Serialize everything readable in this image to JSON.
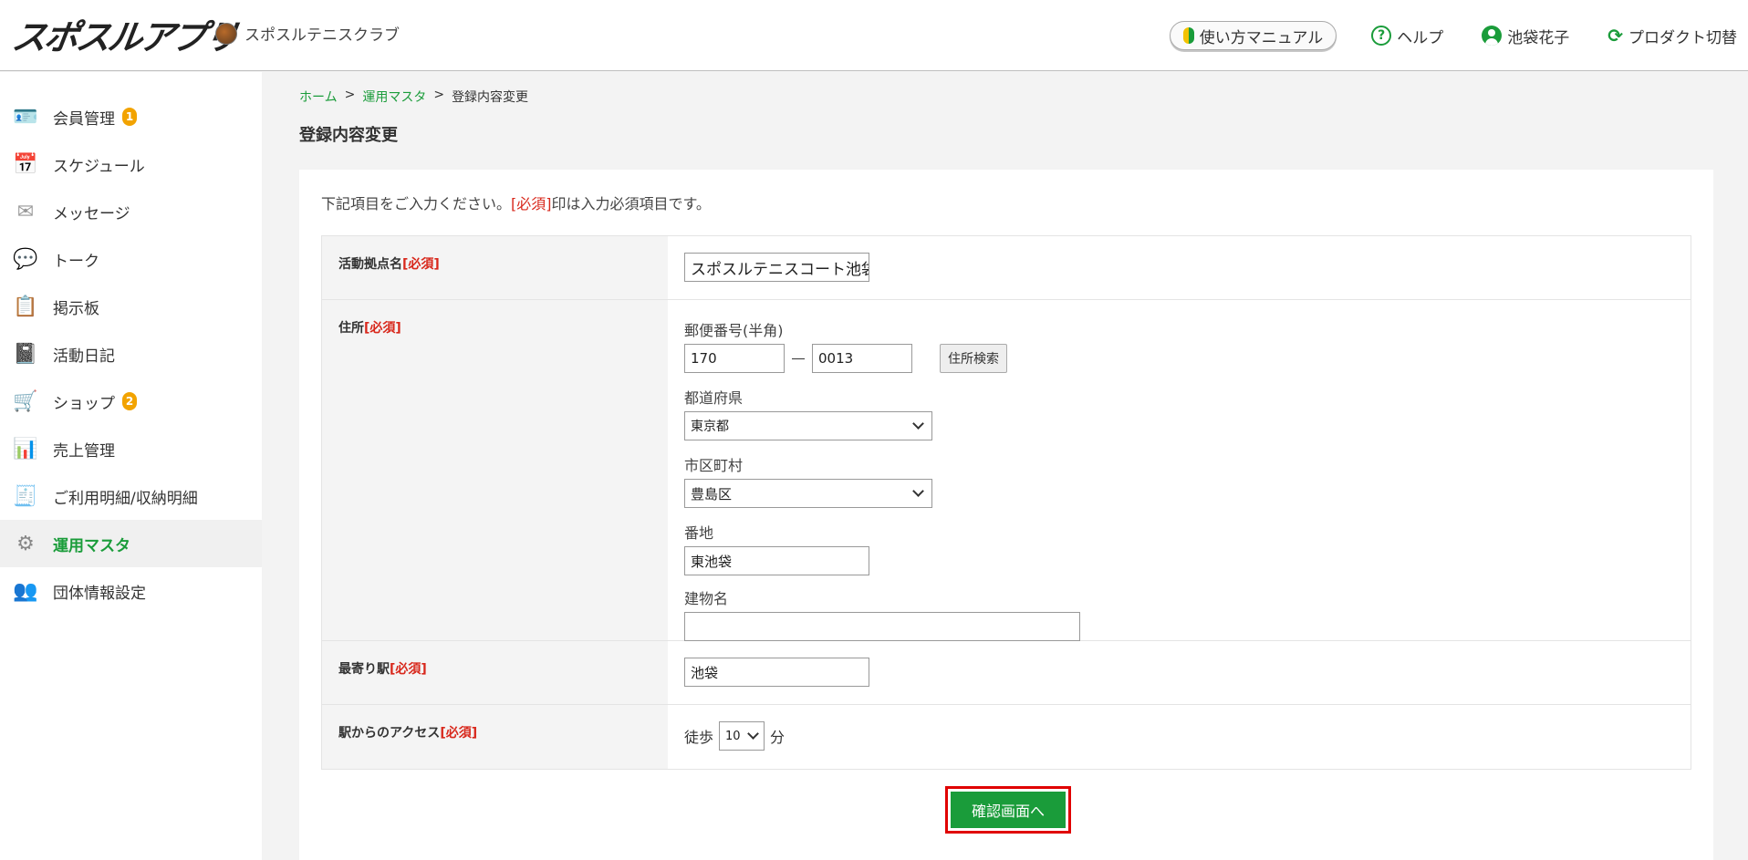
{
  "header": {
    "logo": "スポスルアプリ",
    "club_name": "スポスルテニスクラブ",
    "manual_label": "使い方マニュアル",
    "help_label": "ヘルプ",
    "user_name": "池袋花子",
    "product_switch_label": "プロダクト切替"
  },
  "sidebar": {
    "items": [
      {
        "label": "会員管理",
        "icon": "member-card-icon",
        "badge": "1"
      },
      {
        "label": "スケジュール",
        "icon": "calendar-icon"
      },
      {
        "label": "メッセージ",
        "icon": "envelope-icon"
      },
      {
        "label": "トーク",
        "icon": "chat-bubble-icon"
      },
      {
        "label": "掲示板",
        "icon": "bulletin-board-icon"
      },
      {
        "label": "活動日記",
        "icon": "diary-icon"
      },
      {
        "label": "ショップ",
        "icon": "cart-icon",
        "badge": "2"
      },
      {
        "label": "売上管理",
        "icon": "sales-chart-icon"
      },
      {
        "label": "ご利用明細/収納明細",
        "icon": "receipt-icon"
      },
      {
        "label": "運用マスタ",
        "icon": "gear-icon",
        "active": true
      },
      {
        "label": "団体情報設定",
        "icon": "group-settings-icon"
      }
    ]
  },
  "breadcrumb": {
    "home": "ホーム",
    "sep": ">",
    "master": "運用マスタ",
    "current": "登録内容変更"
  },
  "page_title": "登録内容変更",
  "form": {
    "intro_before": "下記項目をご入力ください。",
    "intro_req": "[必須]",
    "intro_after": "印は入力必須項目です。",
    "req_mark": "[必須]",
    "venue": {
      "label": "活動拠点名",
      "value": "スポスルテニスコート池袋"
    },
    "address": {
      "label": "住所",
      "zip_label": "郵便番号(半角)",
      "zip1": "170",
      "zip2": "0013",
      "search_button": "住所検索",
      "prefecture_label": "都道府県",
      "prefecture": "東京都",
      "city_label": "市区町村",
      "city": "豊島区",
      "street_label": "番地",
      "street": "東池袋",
      "building_label": "建物名",
      "building": ""
    },
    "station": {
      "label": "最寄り駅",
      "value": "池袋"
    },
    "access": {
      "label": "駅からのアクセス",
      "walk": "徒歩",
      "minutes": "10",
      "unit": "分"
    }
  },
  "confirm_button": "確認画面へ"
}
